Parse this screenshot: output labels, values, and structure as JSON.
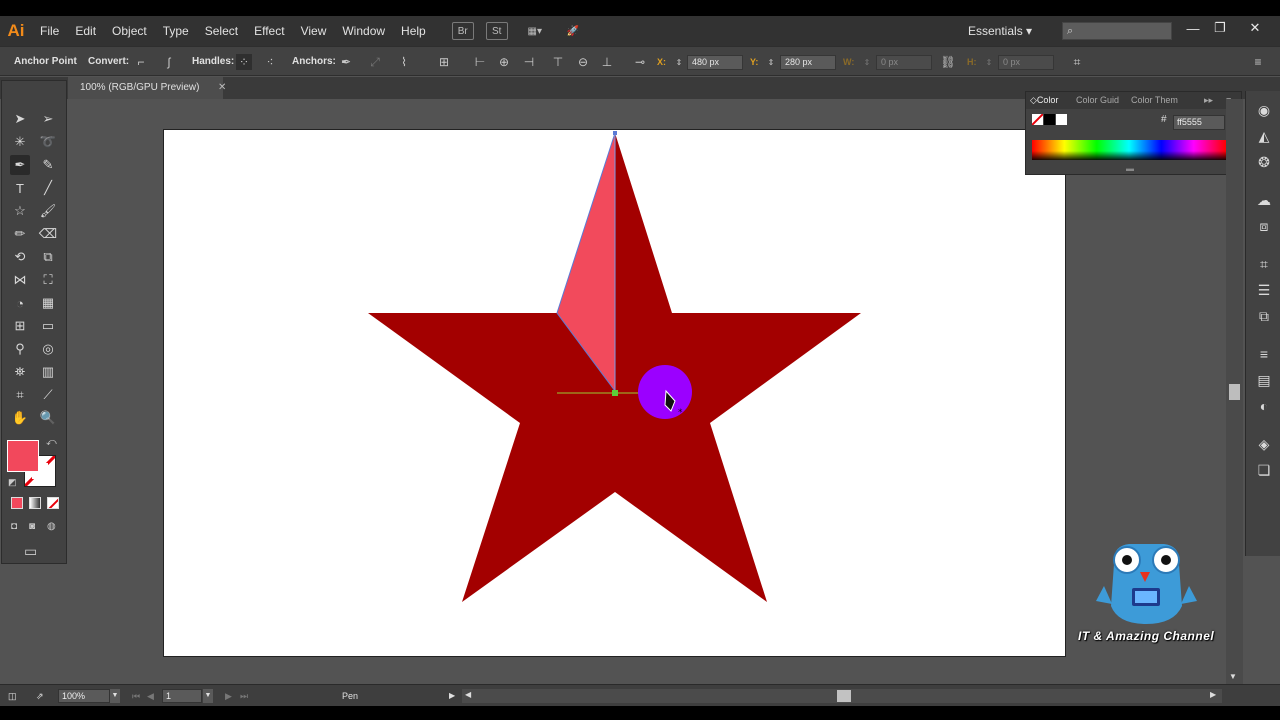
{
  "app": {
    "logo": "Ai"
  },
  "menu": [
    "File",
    "Edit",
    "Object",
    "Type",
    "Select",
    "Effect",
    "View",
    "Window",
    "Help"
  ],
  "menubar_icons": {
    "bridge": "Br",
    "stock": "St",
    "arrange": "▦▾",
    "gpu": "🚀"
  },
  "workspace": {
    "label": "Essentials",
    "chevron": "▾"
  },
  "search": {
    "icon": "⌕",
    "placeholder": ""
  },
  "window_controls": {
    "minimize": "—",
    "restore": "❐",
    "close": "✕"
  },
  "controlbar": {
    "anchor_point": "Anchor Point",
    "convert": "Convert:",
    "handles": "Handles:",
    "anchors": "Anchors:",
    "x_label": "X:",
    "x_value": "480 px",
    "y_label": "Y:",
    "y_value": "280 px",
    "w_label": "W:",
    "w_value": "0 px",
    "h_label": "H:",
    "h_value": "0 px"
  },
  "document_tab": {
    "title": "100% (RGB/GPU Preview)",
    "close": "✕"
  },
  "color_panel": {
    "tabs": [
      "Color",
      "Color Guid",
      "Color Them"
    ],
    "hex_label": "#",
    "hex_value": "ff5555",
    "colors": {
      "fill": "#f2485c",
      "star": "#a30000",
      "highlight": "#f24a5c",
      "cursor_circle": "#9b00ff"
    }
  },
  "status": {
    "zoom": "100%",
    "page": "1",
    "tool": "Pen"
  },
  "watermark": {
    "text": "IT & Amazing Channel"
  }
}
